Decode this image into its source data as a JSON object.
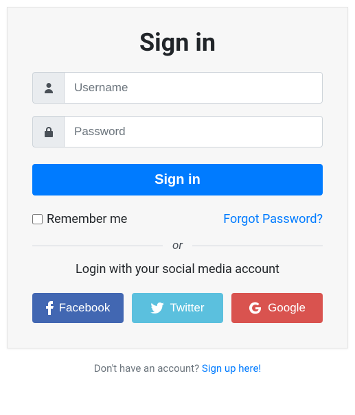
{
  "title": "Sign in",
  "username": {
    "placeholder": "Username",
    "value": ""
  },
  "password": {
    "placeholder": "Password",
    "value": ""
  },
  "submit_label": "Sign in",
  "remember_label": "Remember me",
  "forgot_label": "Forgot Password?",
  "divider_label": "or",
  "social_text": "Login with your social media account",
  "social": {
    "facebook": "Facebook",
    "twitter": "Twitter",
    "google": "Google"
  },
  "footer": {
    "prompt": "Don't have an account? ",
    "link": "Sign up here!"
  },
  "colors": {
    "primary": "#007bff",
    "facebook": "#4267B2",
    "twitter": "#5bc0de",
    "google": "#d9534f"
  }
}
